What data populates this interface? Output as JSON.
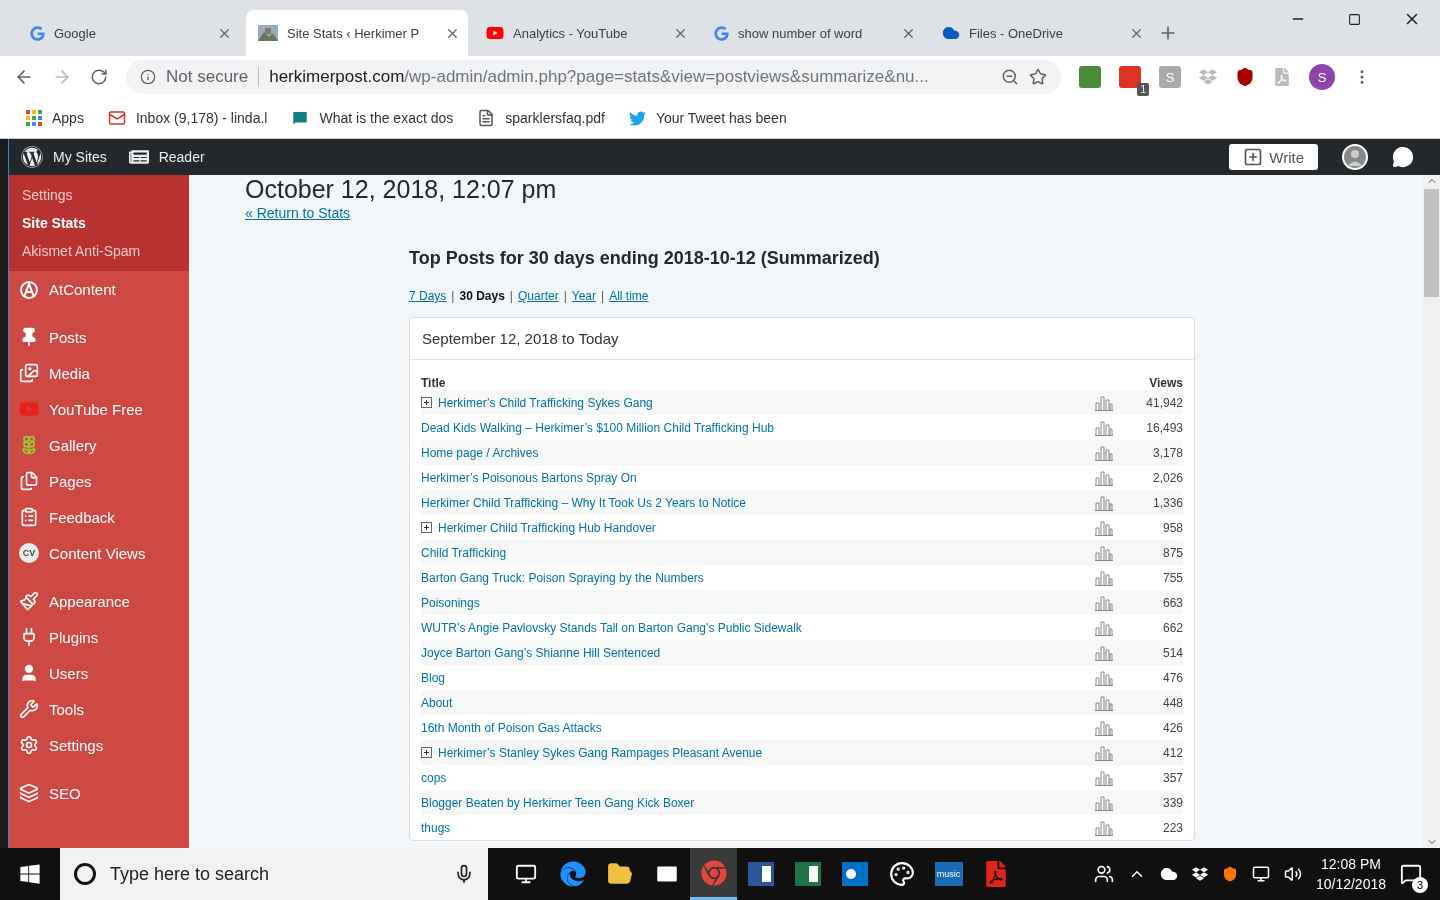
{
  "browser": {
    "tabs": [
      {
        "title": "Google",
        "kind": "google",
        "selected": false
      },
      {
        "title": "Site Stats ‹ Herkimer P",
        "selected": true
      },
      {
        "title": "Analytics - YouTube",
        "kind": "youtube",
        "selected": false
      },
      {
        "title": "show number of word",
        "kind": "google",
        "selected": false
      },
      {
        "title": "Files - OneDrive",
        "kind": "onedrive",
        "selected": false
      }
    ],
    "security": "Not secure",
    "url_host": "herkimerpost.com",
    "url_path": "/wp-admin/admin.php?page=stats&view=postviews&summarize&nu...",
    "extensions": [
      {
        "kind": "evernote"
      },
      {
        "kind": "red",
        "badge": "1"
      },
      {
        "kind": "letter",
        "label": "S"
      },
      {
        "kind": "dropbox"
      },
      {
        "kind": "shield"
      },
      {
        "kind": "acrobat"
      }
    ],
    "profile": "S",
    "bookmarks": [
      {
        "label": "Apps",
        "kind": "apps"
      },
      {
        "label": "Inbox (9,178) - linda.l",
        "kind": "gmail"
      },
      {
        "label": "What is the exact dos",
        "kind": "chat"
      },
      {
        "label": "sparklersfaq.pdf",
        "kind": "file"
      },
      {
        "label": "Your Tweet has been",
        "kind": "twitter"
      }
    ]
  },
  "admin_bar": {
    "my_sites": "My Sites",
    "reader": "Reader",
    "write": "Write"
  },
  "sidebar": {
    "submenu": [
      {
        "label": "Settings",
        "selected": false
      },
      {
        "label": "Site Stats",
        "selected": true
      },
      {
        "label": "Akismet Anti-Spam",
        "selected": false
      }
    ],
    "menu": [
      {
        "label": "AtContent",
        "kind": "atcontent"
      },
      {
        "kind": "separator"
      },
      {
        "label": "Posts",
        "kind": "pin"
      },
      {
        "label": "Media",
        "kind": "media"
      },
      {
        "label": "YouTube Free",
        "kind": "youtube"
      },
      {
        "label": "Gallery",
        "kind": "gallery"
      },
      {
        "label": "Pages",
        "kind": "pages"
      },
      {
        "label": "Feedback",
        "kind": "feedback"
      },
      {
        "label": "Content Views",
        "kind": "cv",
        "cv": "CV"
      },
      {
        "kind": "separator"
      },
      {
        "label": "Appearance",
        "kind": "brush"
      },
      {
        "label": "Plugins",
        "kind": "plug"
      },
      {
        "label": "Users",
        "kind": "user"
      },
      {
        "label": "Tools",
        "kind": "wrench"
      },
      {
        "label": "Settings",
        "kind": "settings"
      },
      {
        "kind": "separator"
      },
      {
        "label": "SEO",
        "kind": "seo"
      }
    ]
  },
  "page": {
    "date": "October 12, 2018, 12:07 pm",
    "return_link": "« Return to Stats",
    "section_title": "Top Posts for 30 days ending 2018-10-12 (Summarized)",
    "periods": [
      {
        "label": "7 Days",
        "selected": false
      },
      {
        "label": "30 Days",
        "selected": true
      },
      {
        "label": "Quarter",
        "selected": false
      },
      {
        "label": "Year",
        "selected": false
      },
      {
        "label": "All time",
        "selected": false
      }
    ],
    "period_separator": "|",
    "card_title": "September 12, 2018 to Today",
    "columns": [
      "Title",
      "Views"
    ],
    "rows": [
      {
        "title": "Herkimer’s Child Trafficking Sykes Gang",
        "views": "41,942",
        "expandable": true
      },
      {
        "title": "Dead Kids Walking – Herkimer’s $100 Million Child Trafficking Hub",
        "views": "16,493",
        "expandable": false
      },
      {
        "title": "Home page / Archives",
        "views": "3,178",
        "expandable": false
      },
      {
        "title": "Herkimer’s Poisonous Bartons Spray On",
        "views": "2,026",
        "expandable": false
      },
      {
        "title": "Herkimer Child Trafficking – Why It Took Us 2 Years to Notice",
        "views": "1,336",
        "expandable": false
      },
      {
        "title": "Herkimer Child Trafficking Hub Handover",
        "views": "958",
        "expandable": true
      },
      {
        "title": "Child Trafficking",
        "views": "875",
        "expandable": false
      },
      {
        "title": "Barton Gang Truck: Poison Spraying by the Numbers",
        "views": "755",
        "expandable": false
      },
      {
        "title": "Poisonings",
        "views": "663",
        "expandable": false
      },
      {
        "title": "WUTR’s Angie Pavlovsky Stands Tall on Barton Gang’s Public Sidewalk",
        "views": "662",
        "expandable": false
      },
      {
        "title": "Joyce Barton Gang’s Shianne Hill Sentenced",
        "views": "514",
        "expandable": false
      },
      {
        "title": "Blog",
        "views": "476",
        "expandable": false
      },
      {
        "title": "About",
        "views": "448",
        "expandable": false
      },
      {
        "title": "16th Month of Poison Gas Attacks",
        "views": "426",
        "expandable": false
      },
      {
        "title": "Herkimer’s Stanley Sykes Gang Rampages Pleasant Avenue",
        "views": "412",
        "expandable": true
      },
      {
        "title": "cops",
        "views": "357",
        "expandable": false
      },
      {
        "title": "Blogger Beaten by Herkimer Teen Gang Kick Boxer",
        "views": "339",
        "expandable": false
      },
      {
        "title": "thugs",
        "views": "223",
        "expandable": false
      }
    ]
  },
  "taskbar": {
    "search_placeholder": "Type here to search",
    "apps": [
      {
        "kind": "taskview",
        "active": false
      },
      {
        "kind": "edge",
        "active": false
      },
      {
        "kind": "explorer",
        "active": false
      },
      {
        "kind": "mail",
        "active": false
      },
      {
        "kind": "chrome",
        "active": true
      },
      {
        "kind": "word",
        "active": false
      },
      {
        "kind": "excel",
        "active": false
      },
      {
        "kind": "outlook",
        "active": false
      },
      {
        "kind": "paint",
        "active": false
      },
      {
        "kind": "music",
        "label": "music",
        "active": false
      },
      {
        "kind": "acrobat",
        "active": false
      }
    ],
    "time": "12:08 PM",
    "date": "10/12/2018",
    "notifications": "3"
  }
}
